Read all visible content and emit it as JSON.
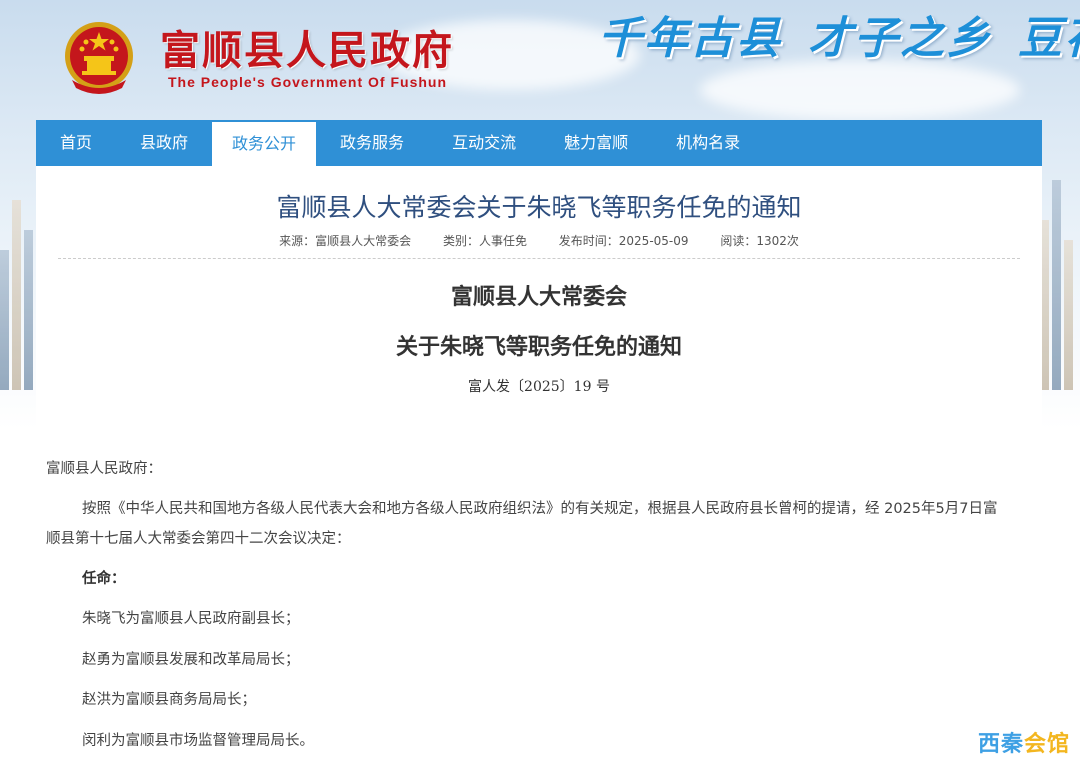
{
  "header": {
    "site_name_cn": "富顺县人民政府",
    "site_name_en": "The People's Government Of Fushun",
    "slogan": [
      "千年古县",
      "才子之乡",
      "豆花"
    ]
  },
  "nav": {
    "items": [
      {
        "label": "首页"
      },
      {
        "label": "县政府"
      },
      {
        "label": "政务公开"
      },
      {
        "label": "政务服务"
      },
      {
        "label": "互动交流"
      },
      {
        "label": "魅力富顺"
      },
      {
        "label": "机构名录"
      }
    ],
    "active_index": 2
  },
  "article": {
    "title": "富顺县人大常委会关于朱晓飞等职务任免的通知",
    "meta": {
      "source": "来源：富顺县人大常委会",
      "category": "类别：人事任免",
      "published": "发布时间：2025-05-09",
      "views": "阅读：1302次"
    },
    "doc_org": "富顺县人大常委会",
    "doc_title": "关于朱晓飞等职务任免的通知",
    "doc_number": "富人发〔2025〕19 号",
    "salutation": "富顺县人民政府：",
    "intro_line1": "按照《中华人民共和国地方各级人民代表大会和地方各级人民政府组织法》的有关规定，根据县人民政府县长曾柯的提请，经 2025年5月7日富",
    "intro_line2": "顺县第十七届人大常委会第四十二次会议决定：",
    "appoint_heading": "任命：",
    "appointments": [
      "朱晓飞为富顺县人民政府副县长；",
      "赵勇为富顺县发展和改革局局长；",
      "赵洪为富顺县商务局局长；",
      "闵利为富顺县市场监督管理局局长。"
    ]
  },
  "watermark": {
    "part1": "西秦",
    "part2": "会馆"
  },
  "colors": {
    "nav_bg": "#2f90d6",
    "site_name": "#c4161c",
    "title": "#2f4f7f",
    "slogan": "#1d8fd8"
  }
}
